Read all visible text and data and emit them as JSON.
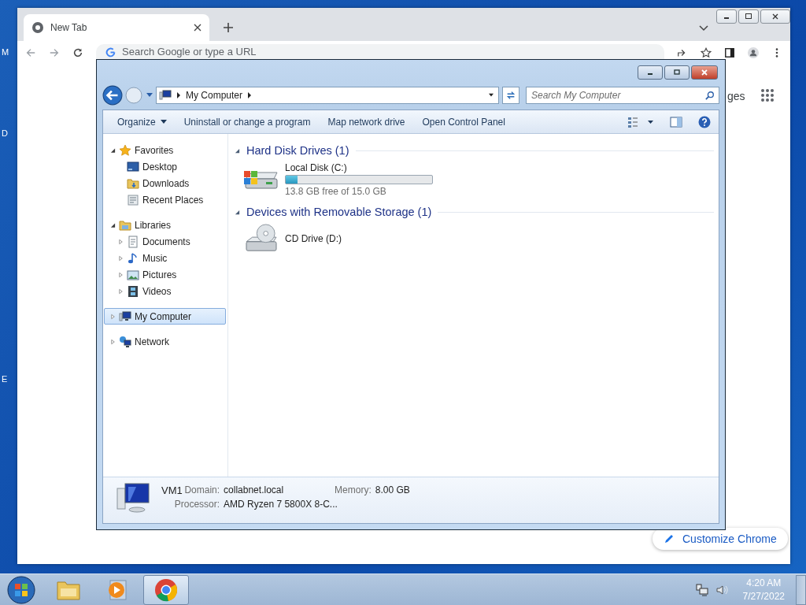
{
  "desktop": {
    "edge_labels": [
      "M",
      "D",
      "E"
    ]
  },
  "chrome": {
    "tabs": [
      {
        "title": "New Tab",
        "selected": true
      }
    ],
    "address": {
      "placeholder": "Search Google or type a URL"
    },
    "page": {
      "link_fragment": "ges",
      "customize_button": "Customize Chrome"
    }
  },
  "explorer": {
    "breadcrumb": [
      "My Computer"
    ],
    "search": {
      "placeholder": "Search My Computer"
    },
    "commands": [
      {
        "label": "Organize",
        "menu": true
      },
      {
        "label": "Uninstall or change a program",
        "menu": false
      },
      {
        "label": "Map network drive",
        "menu": false
      },
      {
        "label": "Open Control Panel",
        "menu": false
      }
    ],
    "nav": [
      {
        "label": "Favorites",
        "kind": "star",
        "expanded": true,
        "selected": false,
        "children": [
          {
            "label": "Desktop",
            "kind": "desktop",
            "selected": false
          },
          {
            "label": "Downloads",
            "kind": "downloads",
            "selected": false
          },
          {
            "label": "Recent Places",
            "kind": "recent",
            "selected": false
          }
        ]
      },
      {
        "label": "Libraries",
        "kind": "library",
        "expanded": true,
        "selected": false,
        "children": [
          {
            "label": "Documents",
            "kind": "documents",
            "expanded": false,
            "selected": false
          },
          {
            "label": "Music",
            "kind": "music",
            "expanded": false,
            "selected": false
          },
          {
            "label": "Pictures",
            "kind": "pictures",
            "expanded": false,
            "selected": false
          },
          {
            "label": "Videos",
            "kind": "videos",
            "expanded": false,
            "selected": false
          }
        ]
      },
      {
        "label": "My Computer",
        "kind": "computer",
        "expanded": false,
        "selected": true
      },
      {
        "label": "Network",
        "kind": "network",
        "expanded": false,
        "selected": false
      }
    ],
    "groups": [
      {
        "title": "Hard Disk Drives (1)",
        "expanded": true,
        "items": [
          {
            "kind": "disk",
            "name": "Local Disk (C:)",
            "level": 0.08,
            "free": "13.8 GB free of 15.0 GB"
          }
        ]
      },
      {
        "title": "Devices with Removable Storage (1)",
        "expanded": true,
        "items": [
          {
            "kind": "cd",
            "name": "CD Drive (D:)"
          }
        ]
      }
    ],
    "details": {
      "name": "VM1",
      "fields": [
        {
          "label": "Domain:",
          "value": "collabnet.local"
        },
        {
          "label": "Memory:",
          "value": "8.00 GB"
        },
        {
          "label": "Processor:",
          "value": "AMD Ryzen 7 5800X 8-C..."
        }
      ]
    }
  },
  "taskbar": {
    "apps": [
      {
        "kind": "explorer",
        "selected": false
      },
      {
        "kind": "media",
        "selected": false
      },
      {
        "kind": "chrome",
        "selected": true
      }
    ],
    "time": "4:20 AM",
    "date": "7/27/2022"
  }
}
